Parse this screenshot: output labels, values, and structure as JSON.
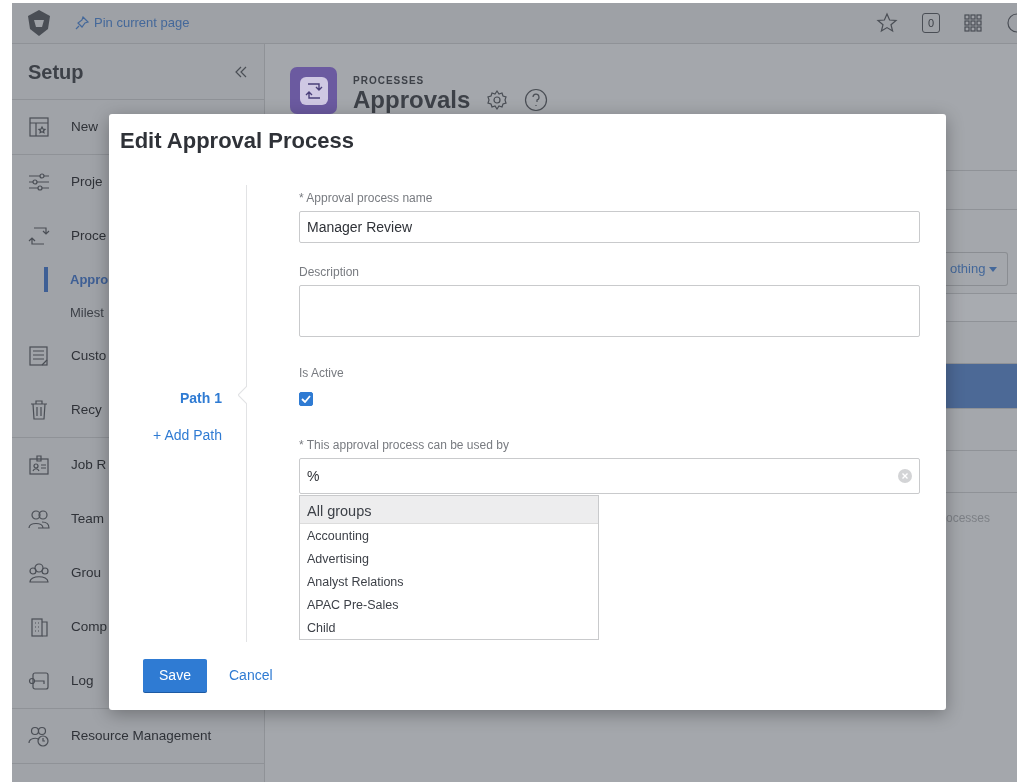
{
  "topbar": {
    "pin_link": "Pin current page",
    "counter": "0"
  },
  "sidebar": {
    "title": "Setup",
    "groups": [
      [
        {
          "label": "New"
        }
      ],
      [
        {
          "label": "Proje"
        },
        {
          "label": "Proce",
          "children": [
            {
              "label": "Appro",
              "selected": true
            },
            {
              "label": "Milest",
              "selected": false
            }
          ]
        },
        {
          "label": "Custo"
        },
        {
          "label": "Recy"
        }
      ],
      [
        {
          "label": "Job R"
        },
        {
          "label": "Team"
        },
        {
          "label": "Grou"
        },
        {
          "label": "Comp"
        },
        {
          "label": "Log"
        }
      ],
      [
        {
          "label": "Resource Management"
        }
      ]
    ]
  },
  "page_header": {
    "eyebrow": "PROCESSES",
    "title": "Approvals"
  },
  "background": {
    "filter_button": "othing",
    "list_rows": [
      {
        "selected": false
      },
      {
        "selected": true
      },
      {
        "selected": false
      },
      {
        "selected": false
      }
    ],
    "footer_text": "ocesses"
  },
  "modal": {
    "title": "Edit Approval Process",
    "paths": [
      {
        "label": "Path 1",
        "selected": true
      }
    ],
    "add_path": "+ Add Path",
    "fields": [
      {
        "kind": "text",
        "label": "* Approval process name",
        "value": "Manager Review"
      },
      {
        "kind": "textarea",
        "label": "Description"
      },
      {
        "kind": "checkbox",
        "label": "Is Active",
        "checked": true
      },
      {
        "kind": "select",
        "label": "* This approval process can be used by",
        "value": "%",
        "options": [
          {
            "label": "All groups",
            "selected": true
          },
          {
            "label": "Accounting",
            "selected": false
          },
          {
            "label": "Advertising",
            "selected": false
          },
          {
            "label": "Analyst Relations",
            "selected": false
          },
          {
            "label": "APAC Pre-Sales",
            "selected": false
          },
          {
            "label": "Child",
            "selected": false
          }
        ]
      }
    ],
    "save": "Save",
    "cancel": "Cancel"
  }
}
